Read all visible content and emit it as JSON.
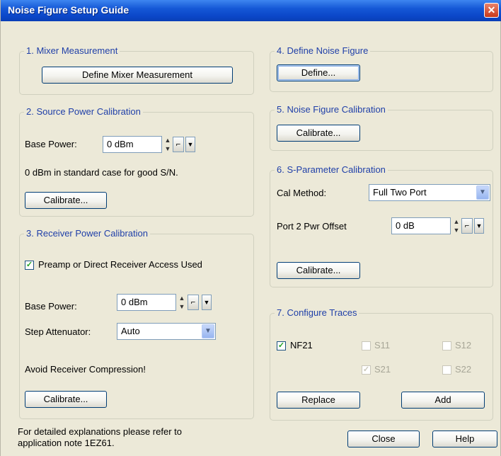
{
  "window": {
    "title": "Noise Figure Setup Guide",
    "close_glyph": "✕"
  },
  "mixer": {
    "title": "1. Mixer Measurement",
    "button": "Define Mixer Measurement"
  },
  "source_power": {
    "title": "2. Source Power Calibration",
    "base_power_label": "Base Power:",
    "base_power_value": "0 dBm",
    "hint": "0 dBm in standard case for good S/N.",
    "calibrate": "Calibrate..."
  },
  "receiver_power": {
    "title": "3. Receiver Power Calibration",
    "preamp_checked": true,
    "preamp_label": "Preamp or Direct Receiver Access Used",
    "base_power_label": "Base Power:",
    "base_power_value": "0 dBm",
    "step_att_label": "Step Attenuator:",
    "step_att_value": "Auto",
    "warning": "Avoid Receiver Compression!",
    "calibrate": "Calibrate..."
  },
  "define_nf": {
    "title": "4. Define Noise Figure",
    "button": "Define..."
  },
  "nf_cal": {
    "title": "5. Noise Figure Calibration",
    "button": "Calibrate..."
  },
  "sparam_cal": {
    "title": "6. S-Parameter Calibration",
    "cal_method_label": "Cal Method:",
    "cal_method_value": "Full Two Port",
    "port2_label": "Port 2 Pwr Offset",
    "port2_value": "0 dB",
    "calibrate": "Calibrate..."
  },
  "traces": {
    "title": "7. Configure Traces",
    "nf21": {
      "label": "NF21",
      "checked": true,
      "enabled": true
    },
    "s11": {
      "label": "S11",
      "checked": false,
      "enabled": false
    },
    "s12": {
      "label": "S12",
      "checked": false,
      "enabled": false
    },
    "s21": {
      "label": "S21",
      "checked": true,
      "enabled": false
    },
    "s22": {
      "label": "S22",
      "checked": false,
      "enabled": false
    },
    "replace": "Replace",
    "add": "Add"
  },
  "footer": {
    "note_line1": "For detailed explanations please refer to",
    "note_line2": "application note 1EZ61.",
    "close": "Close",
    "help": "Help"
  },
  "glyphs": {
    "check": "✓",
    "spin_up": "▲",
    "spin_down": "▼",
    "dropdown": "▼",
    "step": "⌐"
  }
}
